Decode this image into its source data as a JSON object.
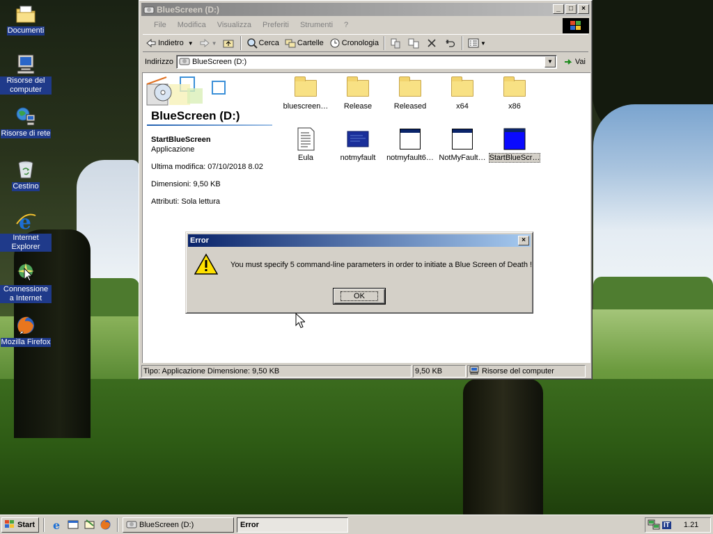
{
  "desktop": {
    "icons": [
      {
        "label": "Documenti",
        "icon": "folder-documents-icon"
      },
      {
        "label": "Risorse del computer",
        "icon": "my-computer-icon"
      },
      {
        "label": "Risorse di rete",
        "icon": "network-icon"
      },
      {
        "label": "Cestino",
        "icon": "recycle-bin-icon"
      },
      {
        "label": "Internet Explorer",
        "icon": "internet-explorer-icon"
      },
      {
        "label": "Connessione a Internet",
        "icon": "internet-connection-icon"
      },
      {
        "label": "Mozilla Firefox",
        "icon": "firefox-icon"
      }
    ]
  },
  "window": {
    "title": "BlueScreen (D:)",
    "menu": [
      "File",
      "Modifica",
      "Visualizza",
      "Preferiti",
      "Strumenti",
      "?"
    ],
    "toolbar": {
      "back": "Indietro",
      "search": "Cerca",
      "folders": "Cartelle",
      "history": "Cronologia"
    },
    "address": {
      "label": "Indirizzo",
      "value": "BlueScreen (D:)",
      "go": "Vai"
    },
    "info_panel": {
      "title": "BlueScreen (D:)",
      "item_name": "StartBlueScreen",
      "item_type": "Applicazione",
      "modified": "Ultima modifica: 07/10/2018 8.02",
      "size": "Dimensioni: 9,50 KB",
      "attributes": "Attributi: Sola lettura"
    },
    "files": [
      {
        "name": "bluescreen…",
        "kind": "folder"
      },
      {
        "name": "Release",
        "kind": "folder"
      },
      {
        "name": "Released",
        "kind": "folder"
      },
      {
        "name": "x64",
        "kind": "folder"
      },
      {
        "name": "x86",
        "kind": "folder"
      },
      {
        "name": "Eula",
        "kind": "document"
      },
      {
        "name": "notmyfault",
        "kind": "app-blue"
      },
      {
        "name": "notmyfault6…",
        "kind": "app"
      },
      {
        "name": "NotMyFault…",
        "kind": "app"
      },
      {
        "name": "StartBlueScr…",
        "kind": "app-selected"
      }
    ],
    "status": {
      "type_text": "Tipo: Applicazione Dimensione: 9,50 KB",
      "size": "9,50 KB",
      "zone": "Risorse del computer"
    }
  },
  "dialog": {
    "title": "Error",
    "message": "You must specify 5 command-line parameters in order to initiate a Blue Screen of Death !",
    "ok": "OK"
  },
  "taskbar": {
    "start": "Start",
    "tasks": [
      {
        "label": "BlueScreen (D:)",
        "active": false
      },
      {
        "label": "Error",
        "active": true
      }
    ],
    "language": "IT",
    "clock": "1.21"
  },
  "colors": {
    "titlebar_active": "#0a246a",
    "titlebar_inactive": "#808080",
    "face": "#d4d0c8"
  }
}
